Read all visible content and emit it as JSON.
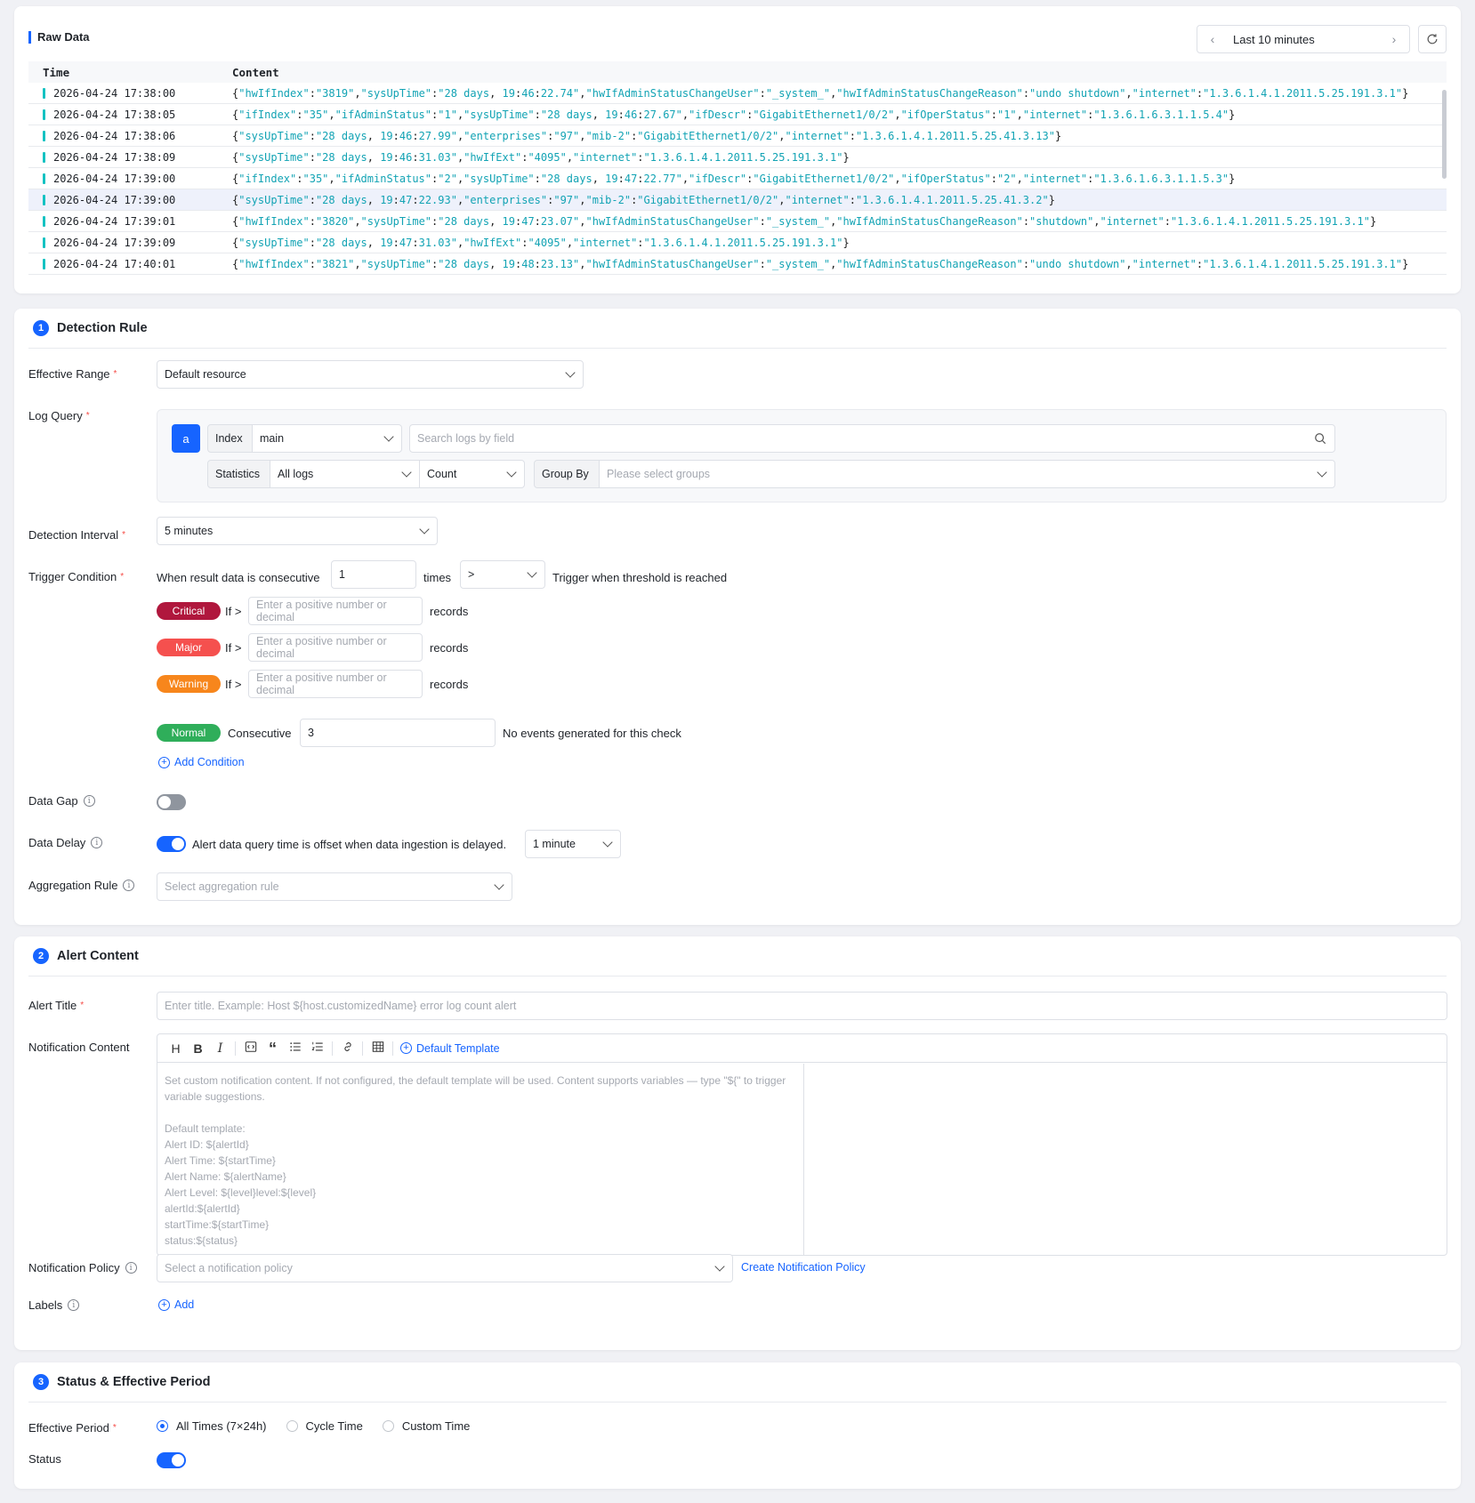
{
  "raw": {
    "title": "Raw Data",
    "time_range": "Last 10 minutes",
    "col_time": "Time",
    "col_content": "Content",
    "rows": [
      {
        "time": "2026-04-24 17:38:00",
        "content": "{\"hwIfIndex\":\"3819\",\"sysUpTime\":\"28 days, 19:46:22.74\",\"hwIfAdminStatusChangeUser\":\"_system_\",\"hwIfAdminStatusChangeReason\":\"undo shutdown\",\"internet\":\"1.3.6.1.4.1.2011.5.25.191.3.1\"}"
      },
      {
        "time": "2026-04-24 17:38:05",
        "content": "{\"ifIndex\":\"35\",\"ifAdminStatus\":\"1\",\"sysUpTime\":\"28 days, 19:46:27.67\",\"ifDescr\":\"GigabitEthernet1/0/2\",\"ifOperStatus\":\"1\",\"internet\":\"1.3.6.1.6.3.1.1.5.4\"}"
      },
      {
        "time": "2026-04-24 17:38:06",
        "content": "{\"sysUpTime\":\"28 days, 19:46:27.99\",\"enterprises\":\"97\",\"mib-2\":\"GigabitEthernet1/0/2\",\"internet\":\"1.3.6.1.4.1.2011.5.25.41.3.13\"}"
      },
      {
        "time": "2026-04-24 17:38:09",
        "content": "{\"sysUpTime\":\"28 days, 19:46:31.03\",\"hwIfExt\":\"4095\",\"internet\":\"1.3.6.1.4.1.2011.5.25.191.3.1\"}"
      },
      {
        "time": "2026-04-24 17:39:00",
        "content": "{\"ifIndex\":\"35\",\"ifAdminStatus\":\"2\",\"sysUpTime\":\"28 days, 19:47:22.77\",\"ifDescr\":\"GigabitEthernet1/0/2\",\"ifOperStatus\":\"2\",\"internet\":\"1.3.6.1.6.3.1.1.5.3\"}"
      },
      {
        "time": "2026-04-24 17:39:00",
        "content": "{\"sysUpTime\":\"28 days, 19:47:22.93\",\"enterprises\":\"97\",\"mib-2\":\"GigabitEthernet1/0/2\",\"internet\":\"1.3.6.1.4.1.2011.5.25.41.3.2\"}"
      },
      {
        "time": "2026-04-24 17:39:01",
        "content": "{\"hwIfIndex\":\"3820\",\"sysUpTime\":\"28 days, 19:47:23.07\",\"hwIfAdminStatusChangeUser\":\"_system_\",\"hwIfAdminStatusChangeReason\":\"shutdown\",\"internet\":\"1.3.6.1.4.1.2011.5.25.191.3.1\"}"
      },
      {
        "time": "2026-04-24 17:39:09",
        "content": "{\"sysUpTime\":\"28 days, 19:47:31.03\",\"hwIfExt\":\"4095\",\"internet\":\"1.3.6.1.4.1.2011.5.25.191.3.1\"}"
      },
      {
        "time": "2026-04-24 17:40:01",
        "content": "{\"hwIfIndex\":\"3821\",\"sysUpTime\":\"28 days, 19:48:23.13\",\"hwIfAdminStatusChangeUser\":\"_system_\",\"hwIfAdminStatusChangeReason\":\"undo shutdown\",\"internet\":\"1.3.6.1.4.1.2011.5.25.191.3.1\"}"
      }
    ]
  },
  "detection": {
    "num": "1",
    "title": "Detection Rule",
    "effective_range_label": "Effective Range",
    "effective_range_value": "Default resource",
    "log_query_label": "Log Query",
    "query_badge": "a",
    "index_addon": "Index",
    "index_value": "main",
    "search_placeholder": "Search logs by field",
    "statistics_addon": "Statistics",
    "statistics_value": "All logs",
    "agg_value": "Count",
    "group_by_addon": "Group By",
    "group_by_placeholder": "Please select groups",
    "interval_label": "Detection Interval",
    "interval_value": "5 minutes",
    "trigger_label": "Trigger Condition",
    "trigger_prefix": "When result data is consecutive",
    "trigger_times_value": "1",
    "trigger_times": "times",
    "trigger_op": ">",
    "trigger_suffix": "Trigger when threshold is reached",
    "levels": [
      {
        "name": "Critical",
        "if": "If >",
        "placeholder": "Enter a positive number or decimal",
        "unit": "records",
        "color": "#b0173d"
      },
      {
        "name": "Major",
        "if": "If >",
        "placeholder": "Enter a positive number or decimal",
        "unit": "records",
        "color": "#f5504e"
      },
      {
        "name": "Warning",
        "if": "If >",
        "placeholder": "Enter a positive number or decimal",
        "unit": "records",
        "color": "#f7861c"
      }
    ],
    "normal": {
      "name": "Normal",
      "consecutive": "Consecutive",
      "value": "3",
      "note": "No events generated for this check",
      "color": "#2fae5a"
    },
    "add_condition": "Add Condition",
    "data_gap_label": "Data Gap",
    "data_delay_label": "Data Delay",
    "data_delay_text": "Alert data query time is offset when data ingestion is delayed.",
    "data_delay_value": "1 minute",
    "aggregation_label": "Aggregation Rule",
    "aggregation_placeholder": "Select aggregation rule"
  },
  "alert": {
    "num": "2",
    "title": "Alert Content",
    "title_label": "Alert Title",
    "title_placeholder": "Enter title. Example: Host ${host.customizedName} error log count alert",
    "content_label": "Notification Content",
    "default_template": "Default Template",
    "editor_placeholder": "Set custom notification content. If not configured, the default template will be used. Content supports variables — type \"${\" to trigger variable suggestions.\n\nDefault template:\nAlert ID: ${alertId}\nAlert Time: ${startTime}\nAlert Name: ${alertName}\nAlert Level: ${level}level:${level}\nalertId:${alertId}\nstartTime:${startTime}\nstatus:${status}",
    "policy_label": "Notification Policy",
    "policy_placeholder": "Select a notification policy",
    "create_policy": "Create Notification Policy",
    "labels_label": "Labels",
    "add": "Add"
  },
  "status": {
    "num": "3",
    "title": "Status & Effective Period",
    "period_label": "Effective Period",
    "options": [
      "All Times (7×24h)",
      "Cycle Time",
      "Custom Time"
    ],
    "selected": "All Times (7×24h)",
    "status_label": "Status"
  },
  "colors": {
    "accent": "#1664ff",
    "key": "#12a3b4"
  }
}
